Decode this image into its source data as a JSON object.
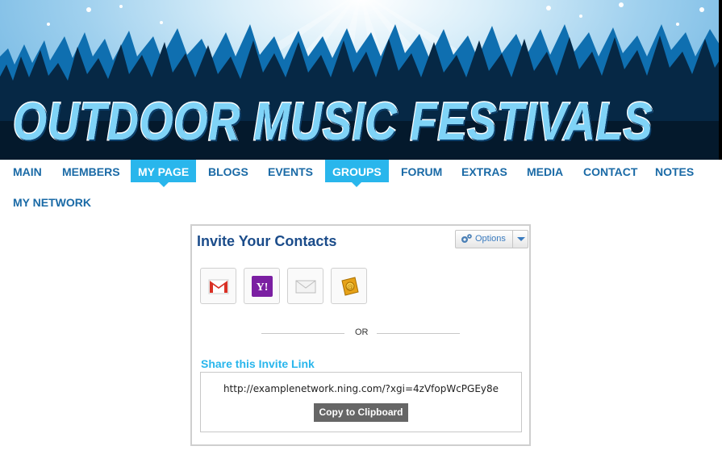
{
  "banner": {
    "title": "Outdoor Music Festivals"
  },
  "nav": {
    "items": [
      {
        "label": "MAIN",
        "active": false
      },
      {
        "label": "MEMBERS",
        "active": false
      },
      {
        "label": "MY PAGE",
        "active": true
      },
      {
        "label": "BLOGS",
        "active": false
      },
      {
        "label": "EVENTS",
        "active": false
      },
      {
        "label": "GROUPS",
        "active": true
      },
      {
        "label": "FORUM",
        "active": false
      },
      {
        "label": "EXTRAS",
        "active": false
      },
      {
        "label": "MEDIA",
        "active": false
      },
      {
        "label": "CONTACT",
        "active": false
      },
      {
        "label": "NOTES",
        "active": false
      },
      {
        "label": "MY NETWORK",
        "active": false
      }
    ]
  },
  "invite": {
    "title": "Invite Your Contacts",
    "options_label": "Options",
    "providers": [
      {
        "name": "gmail-icon"
      },
      {
        "name": "yahoo-icon",
        "text": "Y!"
      },
      {
        "name": "email-icon"
      },
      {
        "name": "address-book-icon"
      }
    ],
    "or_text": "OR",
    "share_label": "Share this Invite Link",
    "share_url": "http://examplenetwork.ning.com/?xgi=4zVfopWcPGEy8e",
    "copy_button": "Copy to Clipboard"
  },
  "colors": {
    "nav_text": "#1a6aa6",
    "nav_active_bg": "#29b6ec",
    "title": "#1b4c8a",
    "share_label": "#29b6ec",
    "copy_button_bg": "#666666"
  }
}
